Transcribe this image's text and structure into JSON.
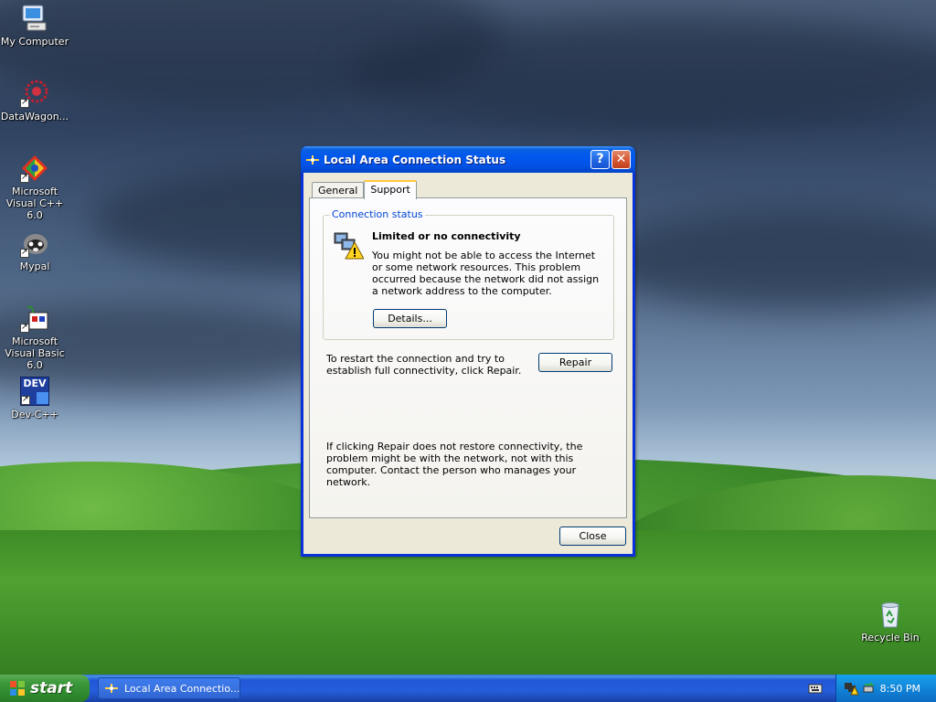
{
  "desktop": {
    "icons": [
      {
        "label": "My Computer",
        "icon": "my-computer-icon"
      },
      {
        "label": "DataWagon...",
        "icon": "datawagon-icon"
      },
      {
        "label": "Microsoft Visual C++ 6.0",
        "icon": "visual-cpp-icon"
      },
      {
        "label": "Mypal",
        "icon": "mypal-icon"
      },
      {
        "label": "Microsoft Visual Basic 6.0",
        "icon": "visual-basic-icon"
      },
      {
        "label": "Dev-C++",
        "icon": "dev-cpp-icon",
        "badge": "DEV"
      },
      {
        "label": "Recycle Bin",
        "icon": "recycle-bin-icon"
      }
    ]
  },
  "window": {
    "title": "Local Area Connection Status",
    "help_button": "?",
    "close_button": "✕",
    "tabs": [
      {
        "label": "General",
        "active": false
      },
      {
        "label": "Support",
        "active": true
      }
    ],
    "group_title": "Connection status",
    "status_heading": "Limited or no connectivity",
    "status_description": "You might not be able to access the Internet or some network resources. This problem occurred because the network did not assign a network address to the computer.",
    "details_button": "Details...",
    "repair_text": "To restart the connection and try to establish full connectivity, click Repair.",
    "repair_button": "Repair",
    "footer_text": "If clicking Repair does not restore connectivity, the problem might be with the network, not with this computer. Contact the person who manages your network.",
    "close_label": "Close"
  },
  "taskbar": {
    "start_label": "start",
    "task_label": "Local Area Connectio...",
    "clock": "8:50 PM"
  },
  "colors": {
    "titlebar": "#0058ee",
    "group_title": "#0046d5",
    "start_button": "#3c993b",
    "tray": "#1590e0"
  }
}
